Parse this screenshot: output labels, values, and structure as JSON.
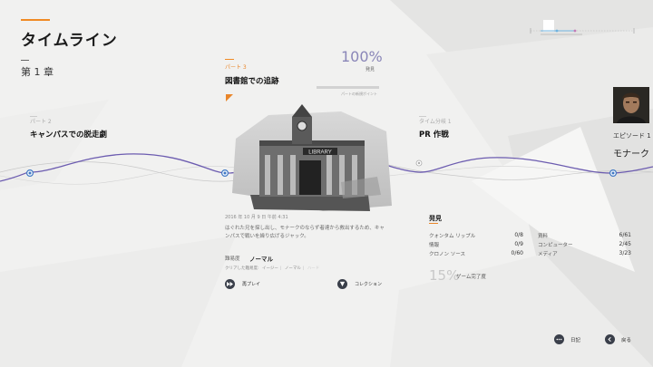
{
  "header": {
    "title": "タイムライン",
    "chapter": "第 1 章"
  },
  "parts": {
    "left": {
      "label": "パート 2",
      "title": "キャンパスでの脱走劇"
    },
    "center": {
      "label": "パート 3",
      "title": "図書館での追跡"
    },
    "right": {
      "label": "タイム分岐 1",
      "title": "PR 作戦"
    },
    "episode": {
      "label": "エピソード 1",
      "title": "モナーク ソ"
    }
  },
  "progress": {
    "percent_text": "100%",
    "percent_sub": "発見",
    "fill_fraction": 1.0,
    "caption": "パートの新規ポイント"
  },
  "detail": {
    "timestamp": "2016 年 10 月 9 日 午前 4:31",
    "description": "はぐれた兄を探し出し、モナークのならず者達から救出するため、キャンパスで戦いを繰り広げるジャック。",
    "difficulty_label": "難易度",
    "difficulty_value": "ノーマル",
    "cleared_label": "クリアした難易度:",
    "cleared_levels": [
      "イージー",
      "ノーマル",
      "ハード"
    ],
    "replay_label": "再プレイ",
    "collection_label": "コレクション",
    "photo_sign": "LIBRARY"
  },
  "discovery": {
    "title": "発見",
    "items": [
      {
        "name": "クォンタム リップル",
        "value": "0/8"
      },
      {
        "name": "情報",
        "value": "0/9"
      },
      {
        "name": "クロノン ソース",
        "value": "0/60"
      },
      {
        "name": "資料",
        "value": "6/61"
      },
      {
        "name": "コンピューター",
        "value": "2/45"
      },
      {
        "name": "メディア",
        "value": "3/23"
      }
    ],
    "completion_percent": "15%",
    "completion_label": "ゲーム完了度"
  },
  "footer": {
    "diary_label": "日記",
    "back_label": "戻る"
  },
  "colors": {
    "accent": "#e9862a",
    "wave": "#6c5cb0",
    "node": "#3f78c4",
    "button": "#3a3f4a"
  }
}
